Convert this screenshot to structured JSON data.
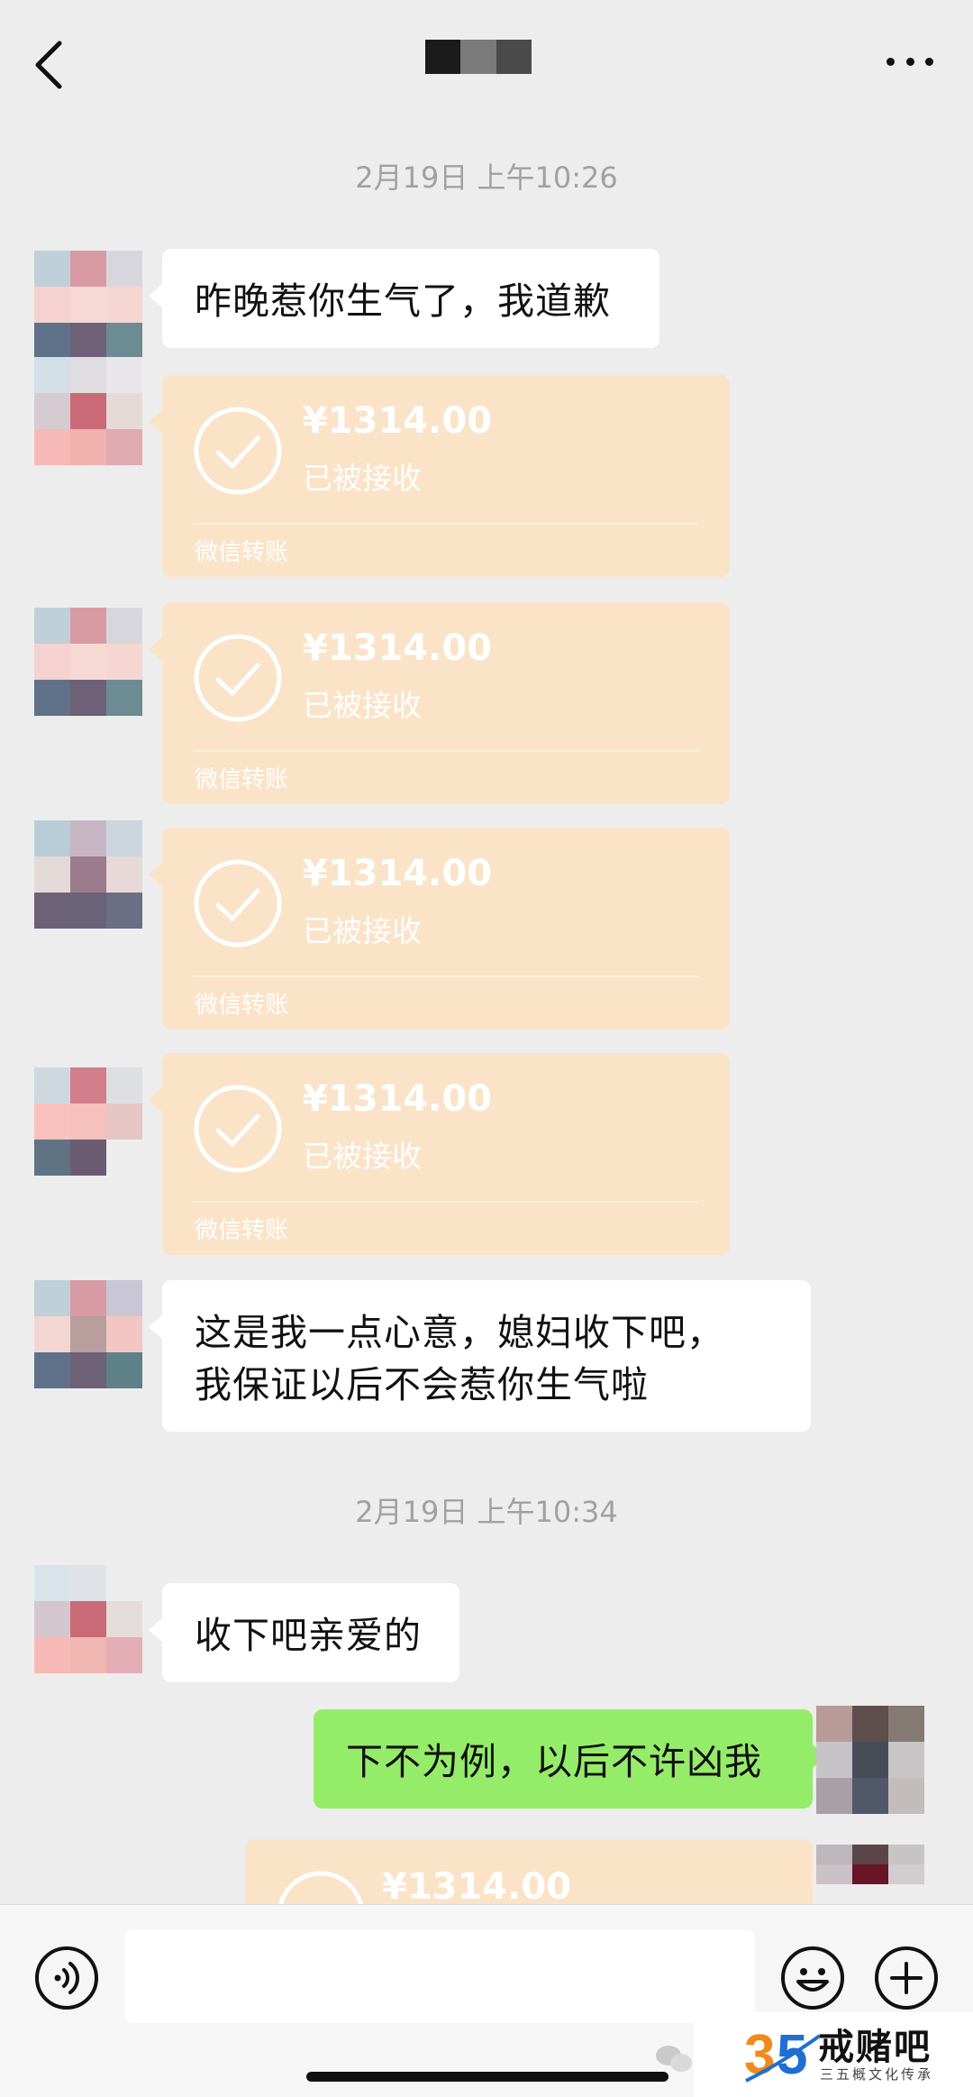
{
  "header": {
    "title_blocks": [
      "#1b1b1b",
      "#7a7a7a",
      "#4a4a4a"
    ],
    "back_icon": "chevron-left-icon",
    "more_icon": "more-dots-icon"
  },
  "messages": {
    "ts1": "2月19日 上午10:26",
    "msg1": "昨晚惹你生气了，我道歉",
    "transfers": [
      {
        "amount": "¥1314.00",
        "status": "已被接收",
        "label": "微信转账"
      },
      {
        "amount": "¥1314.00",
        "status": "已被接收",
        "label": "微信转账"
      },
      {
        "amount": "¥1314.00",
        "status": "已被接收",
        "label": "微信转账"
      },
      {
        "amount": "¥1314.00",
        "status": "已被接收",
        "label": "微信转账"
      }
    ],
    "msg2_line1": "这是我一点心意，媳妇收下吧，",
    "msg2_line2": "我保证以后不会惹你生气啦",
    "ts2": "2月19日 上午10:34",
    "msg3": "收下吧亲爱的",
    "msg4": "下不为例，以后不许凶我",
    "partial_transfer_amount": "¥1314.00"
  },
  "input": {
    "value": "",
    "placeholder": ""
  },
  "footer_icons": [
    "voice-icon",
    "emoji-icon",
    "plus-icon"
  ],
  "watermark": {
    "name": "戒赌吧",
    "sub": "三五概文化传承"
  },
  "colors": {
    "background": "#ededed",
    "bubble_left": "#ffffff",
    "bubble_right": "#95ec69",
    "transfer_card": "#fbe3c8",
    "timestamp": "#a1a1a1"
  }
}
